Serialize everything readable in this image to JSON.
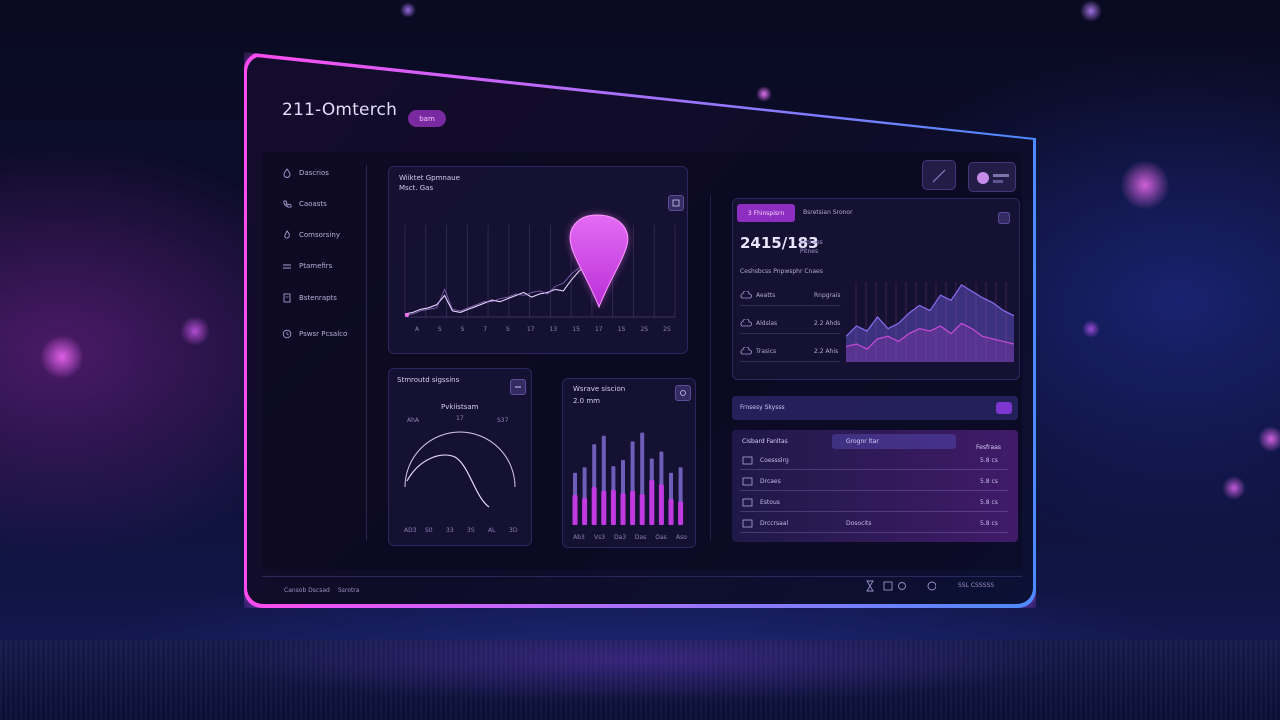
{
  "app": {
    "title": "211-Omterch",
    "badge": "bam"
  },
  "sidebar": {
    "items": [
      {
        "label": "Dascrios",
        "icon": "droplet-icon"
      },
      {
        "label": "Caoasts",
        "icon": "phone-icon"
      },
      {
        "label": "Comsorsiny",
        "icon": "flame-icon"
      },
      {
        "label": "Ptamefirs",
        "icon": "list-icon"
      },
      {
        "label": "Bstenrapts",
        "icon": "document-icon"
      },
      {
        "label": "Pswsr Pcsalco",
        "icon": "clock-icon"
      }
    ]
  },
  "main_chart": {
    "title": "Wiiktet Gpmnaue",
    "subtitle": "Msct. Gas",
    "marker_icon": "location-pin-icon",
    "x_ticks": [
      "A",
      "S",
      "S",
      "7",
      "S",
      "17",
      "13",
      "15",
      "17",
      "1S",
      "2S",
      "2S"
    ]
  },
  "gauge_card": {
    "title": "Stmroutd sigssins",
    "label": "Pvkiistsam",
    "value": "17",
    "left_label": "AhA",
    "right_label": "S37",
    "ticks": [
      "AD3",
      "S0",
      "33",
      "3S",
      "AL",
      "3D"
    ]
  },
  "bars_card": {
    "title": "Wsrave siscion",
    "value": "2.0 mm",
    "ticks": [
      "Ab3",
      "Vs3",
      "Da3",
      "Das",
      "Oas",
      "Aso"
    ]
  },
  "stats_panel": {
    "tabs": [
      {
        "label": "3 Fhinspisrn",
        "active": true
      },
      {
        "label": "Bsretsian Sronor",
        "active": false
      }
    ],
    "big_value": "2415/183",
    "big_sub": [
      "Sroraes",
      "Pitnes"
    ],
    "caption": "Ceshsbcss Pnpwsphr Cnaes",
    "rows": [
      {
        "label": "Aeatts",
        "value": "Rnpgrais",
        "icon": "cloud-icon"
      },
      {
        "label": "Aldslas",
        "value": "2.2 Ahds",
        "icon": "cloud-icon"
      },
      {
        "label": "Trasics",
        "value": "2.2 Ahis",
        "icon": "cloud-icon"
      }
    ]
  },
  "table_section": {
    "title": "Frnsesy Skysss",
    "headers": [
      "Cisbard Fanltas",
      "Grognr ltar",
      "Fesfraas"
    ],
    "rows": [
      {
        "name": "Coessslrg",
        "mid": "",
        "value": "5.8 cs",
        "icon": "list-icon"
      },
      {
        "name": "Drcaes",
        "mid": "",
        "value": "5.8 cs",
        "icon": "chat-icon"
      },
      {
        "name": "Estous",
        "mid": "",
        "value": "5.8 cs",
        "icon": "document-icon"
      },
      {
        "name": "Drccrsaal",
        "mid": "Dosocits",
        "value": "5.8 cs",
        "icon": "document-icon"
      }
    ]
  },
  "footer": {
    "left": "Cansob Dscsad",
    "left_sub": "Ssrotra",
    "right": "SSL CSSSSS"
  },
  "colors": {
    "accent_magenta": "#ff4cf0",
    "accent_purple": "#8d2ec0",
    "accent_blue": "#4c8bff",
    "panel_bg": "#140c2c"
  },
  "chart_data": [
    {
      "type": "line",
      "title": "Wiiktet Gpmnaue",
      "x": [
        1,
        2,
        3,
        4,
        5,
        6,
        7,
        8,
        9,
        10,
        11,
        12,
        13,
        14,
        15,
        16,
        17,
        18,
        19,
        20,
        21,
        22,
        23,
        24
      ],
      "series": [
        {
          "values": [
            2,
            3,
            5,
            6,
            8,
            14,
            4,
            3,
            5,
            7,
            9,
            11,
            10,
            12,
            14,
            16,
            13,
            15,
            16,
            18,
            17,
            24,
            30,
            34
          ]
        },
        {
          "values": [
            1,
            2,
            4,
            5,
            6,
            18,
            5,
            4,
            6,
            8,
            10,
            10,
            12,
            13,
            15,
            14,
            16,
            17,
            15,
            20,
            22,
            28,
            32,
            36
          ]
        }
      ],
      "ylim": [
        0,
        60
      ]
    },
    {
      "type": "area",
      "title": "",
      "series": [
        {
          "values": [
            20,
            28,
            24,
            35,
            26,
            30,
            38,
            44,
            40,
            52,
            48,
            60,
            55,
            50,
            46,
            40,
            36
          ]
        },
        {
          "values": [
            12,
            14,
            10,
            18,
            20,
            16,
            22,
            26,
            24,
            28,
            22,
            30,
            26,
            20,
            18,
            16,
            14
          ]
        }
      ],
      "ylim": [
        0,
        70
      ]
    },
    {
      "type": "bar",
      "title": "Wsrave siscion",
      "categories": [
        "Ab3",
        "Vs3",
        "Da3",
        "Das",
        "Oas",
        "Aso"
      ],
      "series": [
        {
          "values": [
            55,
            85,
            62,
            88,
            70,
            55
          ]
        },
        {
          "values": [
            30,
            38,
            35,
            34,
            45,
            26
          ]
        }
      ],
      "ylim": [
        0,
        100
      ]
    }
  ]
}
